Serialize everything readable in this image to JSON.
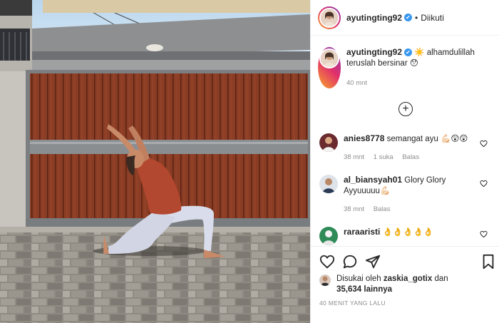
{
  "post": {
    "username": "ayutingting92",
    "verified_mark": "✔",
    "separator": "•",
    "follow_status": "Diikuti",
    "caption_text": "☀️ alhamdulillah teruslah bersinar 😯",
    "caption_time": "40 mnt"
  },
  "load_more": {
    "label": "+"
  },
  "comments": [
    {
      "username": "anies8778",
      "text": "semangat ayu 💪🏻😲😲",
      "time": "38 mnt",
      "likes": "1 suka",
      "reply": "Balas"
    },
    {
      "username": "al_biansyah01",
      "text": "Glory Glory Ayyuuuuu💪🏻",
      "time": "38 mnt",
      "likes": "",
      "reply": "Balas"
    },
    {
      "username": "raraaristi",
      "text": "👌👌👌👌👌",
      "time": "",
      "likes": "",
      "reply": ""
    }
  ],
  "likes": {
    "prefix": "Disukai oleh",
    "user": "zaskia_gotix",
    "joiner": "dan",
    "count": "35,634",
    "suffix": "lainnya"
  },
  "timestamp": "40 MENIT YANG LALU",
  "icons": {
    "like": "heart-icon",
    "comment": "comment-icon",
    "share": "paper-plane-icon",
    "save": "bookmark-icon",
    "comment_like": "heart-icon"
  }
}
